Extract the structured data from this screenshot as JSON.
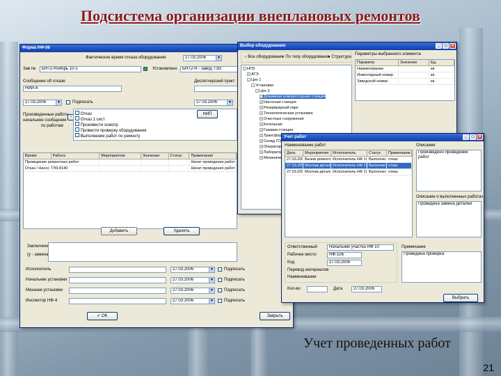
{
  "slide": {
    "title": "Подсистема организации внеплановых ремонтов",
    "caption": "Учет проведенных работ",
    "page_number": "21"
  },
  "form_main": {
    "title": "Форма НФ-06",
    "date_label": "Фактическое время отказа оборудования",
    "date_value": "27.03.2006",
    "row1_label": "Зав №",
    "row1_value": "БНТ2-Ноябрь 10-1",
    "row1_label2": "Установлено",
    "row1_value2": "БНТ2-Н - завод ТЭЗ",
    "row2_label": "Сообщение об отказе",
    "row2_value": "НИИ-4",
    "row2_label2": "Диспетчерский пункт",
    "row3_date": "27.03.2006",
    "row3_label": "Подписать",
    "row3_date2": "27.03.2006",
    "left_block_label": "Произведенные работы",
    "left_block_label2": "начальное сообщение",
    "left_block_label3": "по работам",
    "check_items": [
      "Отказ",
      "Отказ 1 сист",
      "Произвести осмотр",
      "Провести проверку оборудования",
      "Выполнение работ по ремонту"
    ],
    "mini_btn": "НИП",
    "grid_headers": [
      "Время",
      "Работа",
      "Мероприятие",
      "Значение",
      "Статус",
      "Примечание"
    ],
    "grid_rows": [
      [
        "Проведение ремонтных работ",
        "",
        "",
        "",
        "Начат проведения работ"
      ],
      [
        "Отказ / Насос ТЭЗ-8140",
        "",
        "",
        "",
        "Начат проведения работ"
      ]
    ],
    "add_button": "Добавить",
    "delete_button": "Удалить",
    "bottom_label": "Заключение о дефекте",
    "bottom_label2": "(у - замена)",
    "sign_rows": [
      {
        "label": "Исполнитель",
        "date": "27.03.2006",
        "action": "Подписать"
      },
      {
        "label": "Начальник установки",
        "date": "27.03.2006",
        "action": "Подписать"
      },
      {
        "label": "Механик установки",
        "date": "27.03.2006",
        "action": "Подписать"
      },
      {
        "label": "Инспектор НФ-4",
        "date": "27.03.2006",
        "action": "Подписать"
      }
    ],
    "ok_button": "OK",
    "cancel_button": "Закрыть"
  },
  "form_tree": {
    "title": "Выбор оборудования",
    "radio_options": [
      "Все оборудование",
      "По типу оборудования",
      "Структура"
    ],
    "tree_root": [
      "НПЗ",
      "АТЭ",
      "Цех 1",
      "Установки",
      "Цех 3"
    ],
    "tree_items": [
      "Дожимная компрессорная станция",
      "Насосная станция",
      "Резервуарный парк",
      "Технологическая установка",
      "Очистные сооружения",
      "Котельная",
      "Газовая станция",
      "Трансформаторная подстанция",
      "Склад ГСМ",
      "Операторная",
      "Лаборатория",
      "Механическая мастерская"
    ],
    "side_title": "Параметры выбранного элемента",
    "side_headers": [
      "Параметр",
      "Значение",
      "Ед."
    ],
    "side_rows": [
      [
        "Наименование",
        "",
        "кв"
      ],
      [
        "Инвентарный номер",
        "",
        "кв"
      ],
      [
        "Заводской номер",
        "",
        "кв"
      ]
    ]
  },
  "form_works": {
    "title": "Учет работ",
    "top_label": "Наименование работ",
    "grid_headers": [
      "Дата",
      "Мероприятие",
      "Исполнитель",
      "Статус",
      "Примечание"
    ],
    "grid_rows": [
      [
        "27.03.2006",
        "Вызов ремонтной",
        "Исполнитель НФ 10",
        "Выполнено",
        "отказ"
      ],
      [
        "27.03.2006",
        "Монтаж деталей",
        "Исполнитель НФ 10",
        "Выполнено",
        "отказ"
      ],
      [
        "27.03.2006",
        "Монтаж деталей",
        "Исполнитель НФ 10",
        "Выполнено",
        "отказ"
      ]
    ],
    "right_top_label": "Описание",
    "right_top_text": "Произведено проведение работ",
    "right_mid_label": "Описание о выполненных работах",
    "right_mid_text": "Проведена замена деталей",
    "bottom_fields": [
      {
        "label": "Ответственный",
        "value": "Начальник участка НФ 10"
      },
      {
        "label": "Рабочее место",
        "value": "НФ-106"
      },
      {
        "label": "Код",
        "value": "27.03.2006"
      },
      {
        "label": "Перевод материалов",
        "value": ""
      },
      {
        "label": "Наименование",
        "value": ""
      }
    ],
    "right_bottom_label": "Примечание",
    "right_bottom_text": "Проведена проверка",
    "qty_label": "Кол-во",
    "date_label": "Дата",
    "date_value": "27.03.2006",
    "save_button": "Выбрать"
  }
}
